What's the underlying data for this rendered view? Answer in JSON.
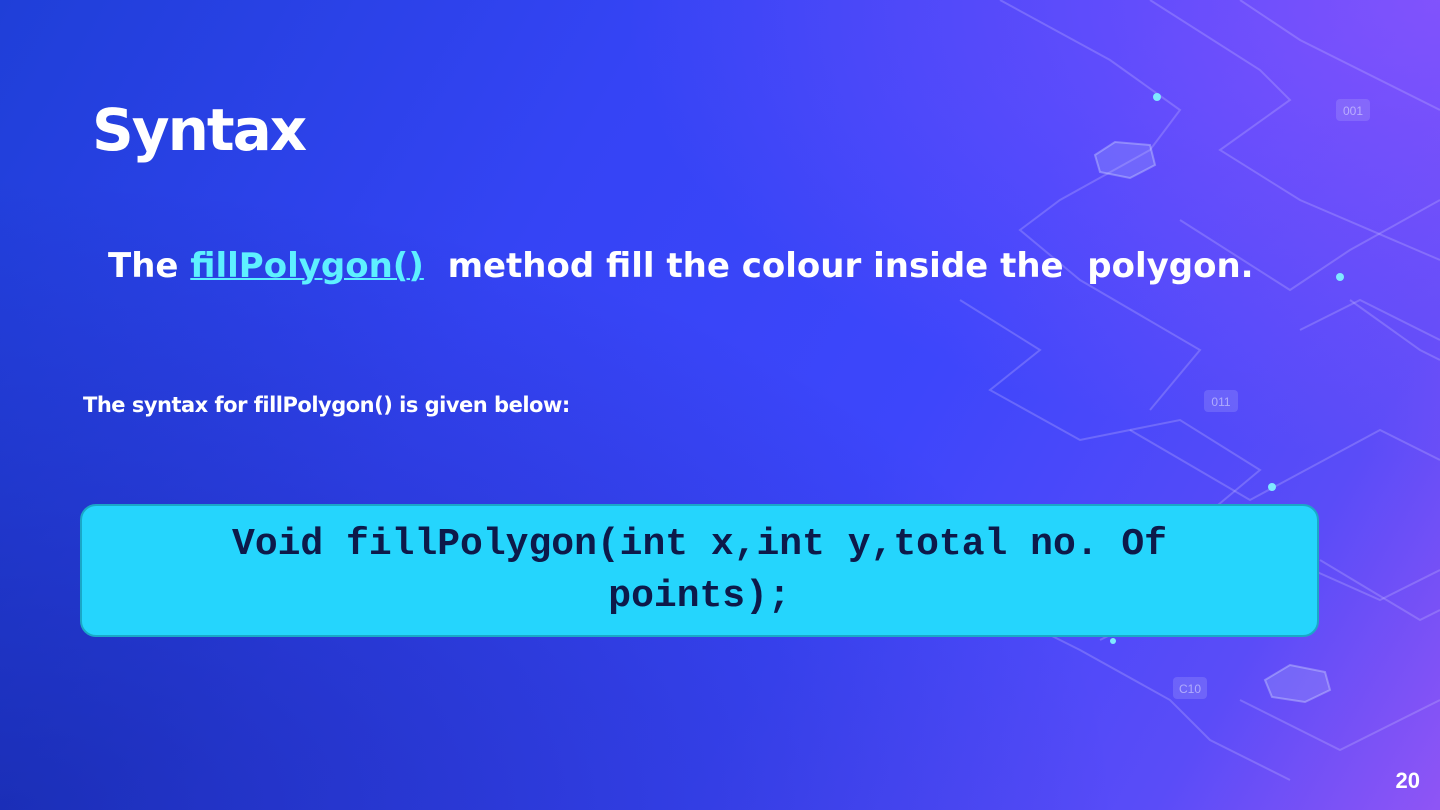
{
  "slide": {
    "title": "Syntax",
    "intro": {
      "prefix": "The ",
      "link_text": "fillPolygon()",
      "suffix": "  method fill the colour inside the  polygon."
    },
    "subtext": "The syntax for fillPolygon() is given below:",
    "code": "Void fillPolygon(int x,int y,total no. Of points);",
    "page_number": "20"
  },
  "decor": {
    "tags": [
      "001",
      "011",
      "C10"
    ]
  },
  "colors": {
    "background_start": "#1f3fd8",
    "background_end": "#8f55f5",
    "link": "#5ef0ff",
    "code_box": "#25d5fd",
    "code_text": "#0d1a4a"
  }
}
